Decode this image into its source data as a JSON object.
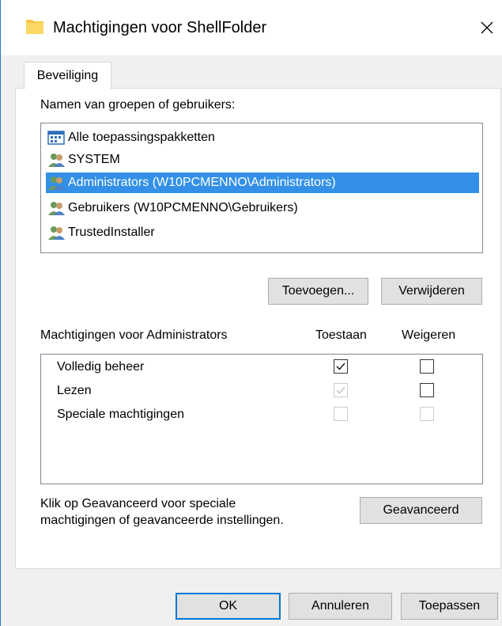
{
  "window": {
    "title": "Machtigingen voor ShellFolder",
    "accent": "#2b78d4"
  },
  "tabs": [
    {
      "label": "Beveiliging",
      "active": true
    }
  ],
  "groups": {
    "label": "Namen van groepen of gebruikers:",
    "items": [
      {
        "label": "Alle toepassingspakketten",
        "icon": "app-packages-icon",
        "selected": false
      },
      {
        "label": "SYSTEM",
        "icon": "users-icon",
        "selected": false
      },
      {
        "label": "Administrators (W10PCMENNO\\Administrators)",
        "icon": "users-icon",
        "selected": true
      },
      {
        "label": "Gebruikers (W10PCMENNO\\Gebruikers)",
        "icon": "users-icon",
        "selected": false
      },
      {
        "label": "TrustedInstaller",
        "icon": "users-icon",
        "selected": false
      }
    ],
    "add_label": "Toevoegen...",
    "remove_label": "Verwijderen"
  },
  "permissions": {
    "header_label": "Machtigingen voor Administrators",
    "allow_header": "Toestaan",
    "deny_header": "Weigeren",
    "rows": [
      {
        "label": "Volledig beheer",
        "allow": true,
        "allow_enabled": true,
        "deny": false,
        "deny_enabled": true
      },
      {
        "label": "Lezen",
        "allow": true,
        "allow_enabled": false,
        "deny": false,
        "deny_enabled": true
      },
      {
        "label": "Speciale machtigingen",
        "allow": false,
        "allow_enabled": false,
        "deny": false,
        "deny_enabled": false
      }
    ]
  },
  "advanced": {
    "text_line1": "Klik op Geavanceerd voor speciale",
    "text_line2": "machtigingen of geavanceerde instellingen.",
    "button_label": "Geavanceerd"
  },
  "footer": {
    "ok_label": "OK",
    "cancel_label": "Annuleren",
    "apply_label": "Toepassen"
  },
  "colors": {
    "selection": "#3390e6",
    "default_button_border": "#0078d7"
  }
}
